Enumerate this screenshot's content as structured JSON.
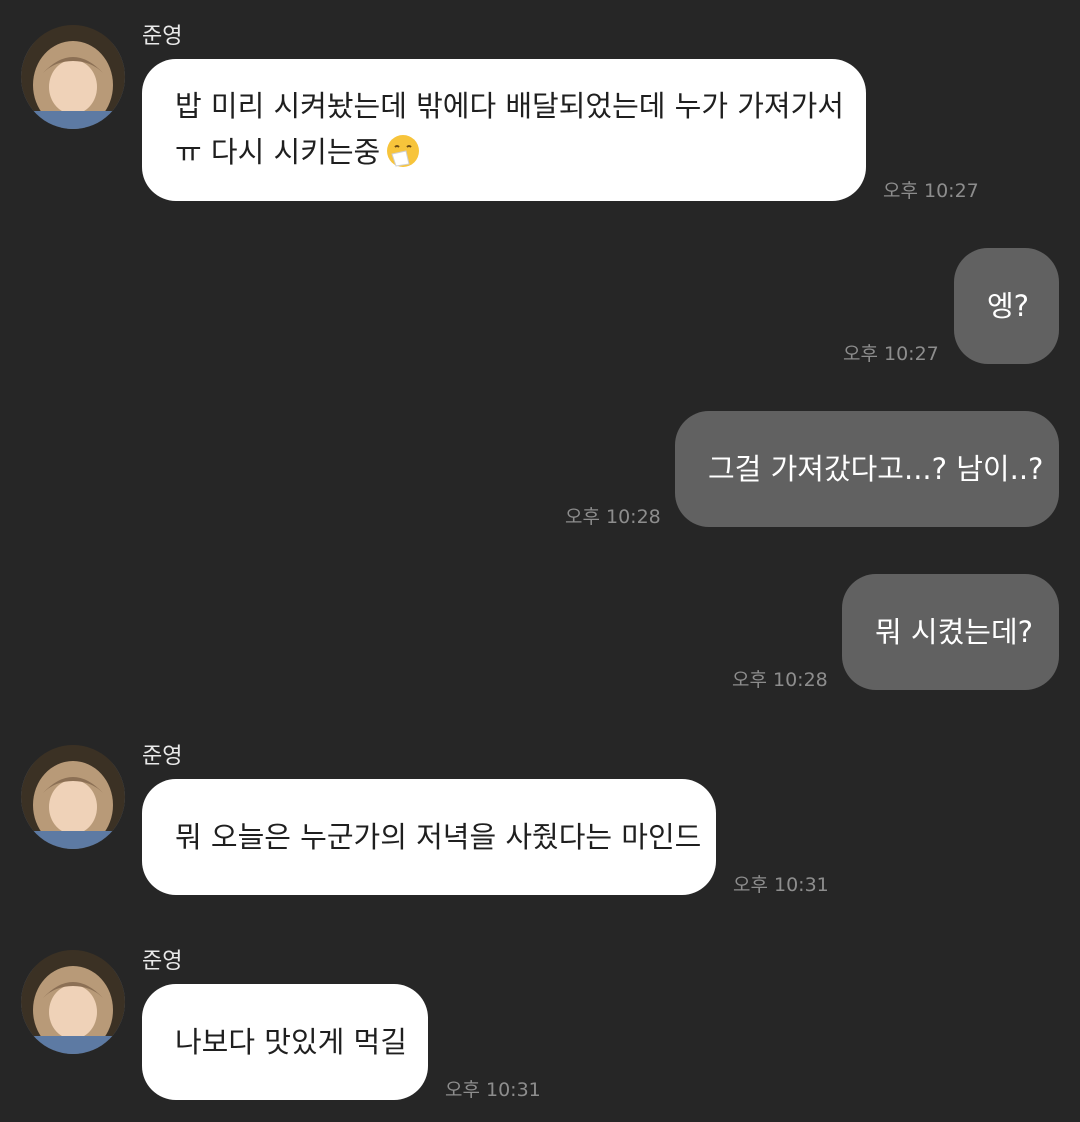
{
  "sender_name": "준영",
  "messages": [
    {
      "side": "in",
      "lines": [
        "밥 미리 시켜놨는데 밖에다 배달되었는데 누가 가져가서",
        "ㅠ 다시 시키는중"
      ],
      "emoji": "sneezing-face-icon",
      "time": "오후 10:27"
    },
    {
      "side": "out",
      "text": "엥?",
      "time": "오후 10:27"
    },
    {
      "side": "out",
      "text": "그걸 가져갔다고...? 남이..?",
      "time": "오후 10:28"
    },
    {
      "side": "out",
      "text": "뭐 시켰는데?",
      "time": "오후 10:28"
    },
    {
      "side": "in",
      "text": "뭐 오늘은 누군가의 저녁을 사줬다는 마인드",
      "time": "오후 10:31"
    },
    {
      "side": "in",
      "text": "나보다 맛있게 먹길",
      "time": "오후 10:31"
    }
  ],
  "colors": {
    "background": "#262626",
    "incoming_bubble": "#ffffff",
    "outgoing_bubble": "#616161",
    "timestamp": "#8d8d8d"
  }
}
